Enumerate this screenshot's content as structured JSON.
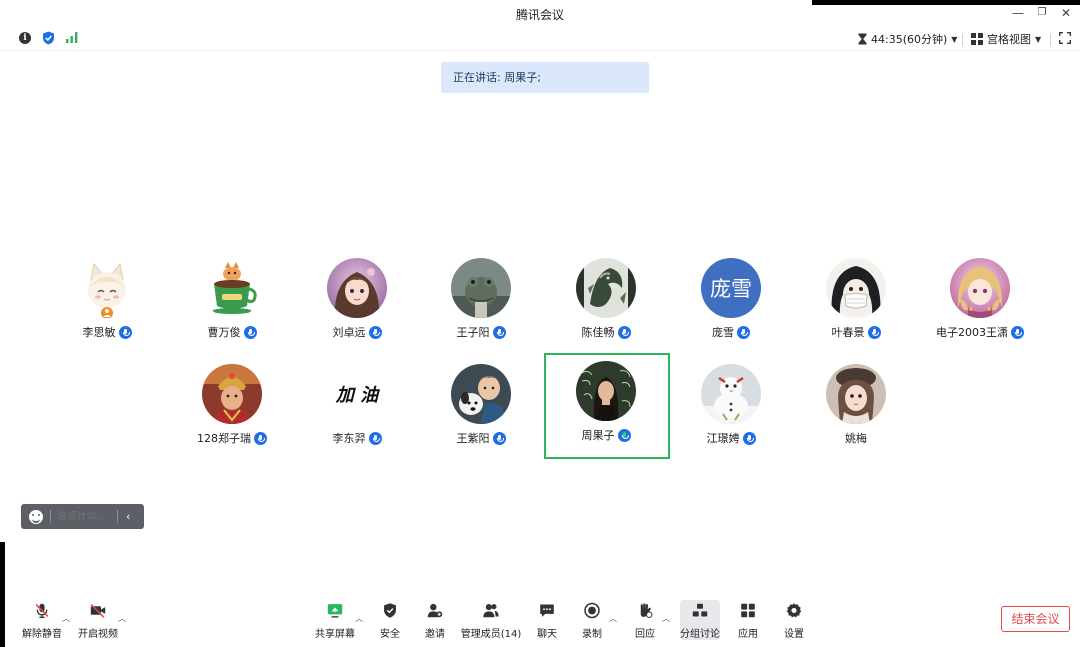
{
  "window": {
    "title": "腾讯会议",
    "minimize_glyph": "—",
    "restore_glyph": "❐",
    "close_glyph": "✕"
  },
  "status_bar": {
    "timer": "44:35(60分钟)",
    "view_mode": "宫格视图"
  },
  "speaking_banner": "正在讲话: 周果子;",
  "participants": [
    {
      "name": "李思敏",
      "avatar": "cat-girl-illustration",
      "mic": "none"
    },
    {
      "name": "曹万俊",
      "avatar": "coffee-cat-illustration",
      "mic": "muted"
    },
    {
      "name": "刘卓远",
      "avatar": "anime-girl-photo",
      "mic": "muted"
    },
    {
      "name": "王子阳",
      "avatar": "frog-photo",
      "mic": "muted"
    },
    {
      "name": "陈佳畅",
      "avatar": "dragon-art",
      "mic": "muted"
    },
    {
      "name": "庞雪",
      "avatar": "text-avatar",
      "avatar_text": "庞雪",
      "avatar_color": "#3e6fc0",
      "mic": "muted"
    },
    {
      "name": "叶春景",
      "avatar": "masked-girl-drawing",
      "mic": "muted"
    },
    {
      "name": "电子2003王潇",
      "avatar": "pink-hair-girl",
      "mic": "muted"
    },
    {
      "name": "128郑子瑞",
      "avatar": "monk-photo",
      "mic": "muted"
    },
    {
      "name": "李东羿",
      "avatar": "text-image",
      "avatar_text": "加 油",
      "mic": "muted"
    },
    {
      "name": "王紫阳",
      "avatar": "child-dog-photo",
      "mic": "muted"
    },
    {
      "name": "周果子",
      "avatar": "chalkboard-girl-photo",
      "mic": "speaking",
      "active": true
    },
    {
      "name": "江璟娉",
      "avatar": "snowman-photo",
      "mic": "muted"
    },
    {
      "name": "姚梅",
      "avatar": "girl-hat-photo",
      "mic": "none"
    }
  ],
  "chat": {
    "placeholder": "说点什么...",
    "collapse_glyph": "‹"
  },
  "toolbar": {
    "unmute": "解除静音",
    "start_video": "开启视频",
    "share_screen": "共享屏幕",
    "security": "安全",
    "invite": "邀请",
    "manage_members": "管理成员(14)",
    "chat": "聊天",
    "record": "录制",
    "reaction": "回应",
    "breakout": "分组讨论",
    "apps": "应用",
    "settings": "设置",
    "end_meeting": "结束会议"
  },
  "colors": {
    "accent_blue": "#1e6ee8",
    "active_speaker_border": "#2bb55f",
    "end_red": "#e14b4b",
    "banner_bg": "#dbe8fb"
  }
}
